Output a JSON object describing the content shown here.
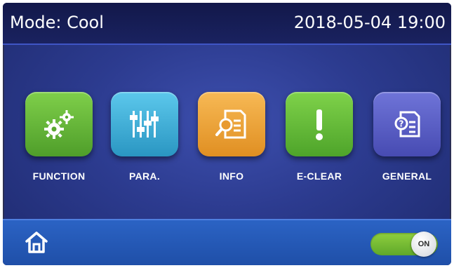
{
  "header": {
    "mode_text": "Mode: Cool",
    "datetime": "2018-05-04 19:00"
  },
  "tiles": [
    {
      "label": "FUNCTION",
      "icon": "gears-icon",
      "color": "#6cbf3d"
    },
    {
      "label": "PARA.",
      "icon": "sliders-icon",
      "color": "#3fb6dc"
    },
    {
      "label": "INFO",
      "icon": "document-search-icon",
      "color": "#f0a640"
    },
    {
      "label": "E-CLEAR",
      "icon": "exclamation-icon",
      "color": "#6cc13c"
    },
    {
      "label": "GENERAL",
      "icon": "document-help-icon",
      "color": "#5b5fc7"
    }
  ],
  "footer": {
    "home_icon": "home-icon",
    "power_toggle": {
      "label": "ON",
      "state": "on",
      "color": "#7cc034"
    }
  }
}
